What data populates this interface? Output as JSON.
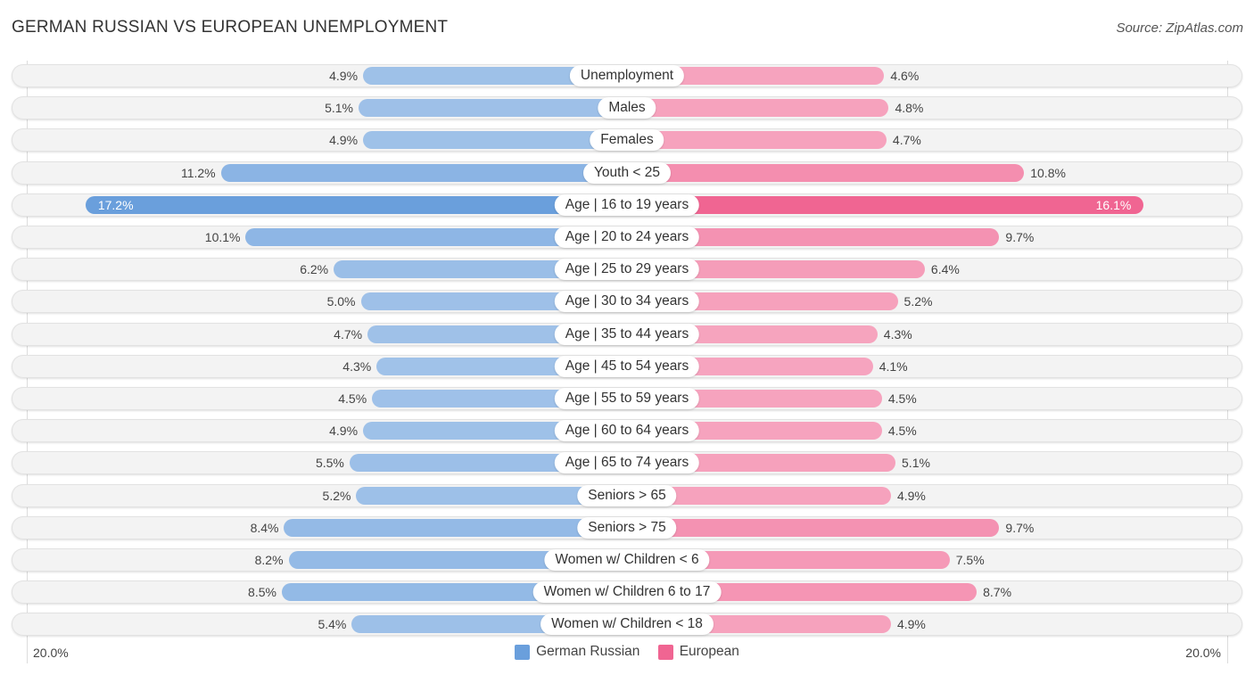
{
  "chart_data": {
    "type": "bar",
    "orientation": "horizontal-diverging",
    "title": "GERMAN RUSSIAN VS EUROPEAN UNEMPLOYMENT",
    "source": "Source: ZipAtlas.com",
    "categories": [
      "Unemployment",
      "Males",
      "Females",
      "Youth < 25",
      "Age | 16 to 19 years",
      "Age | 20 to 24 years",
      "Age | 25 to 29 years",
      "Age | 30 to 34 years",
      "Age | 35 to 44 years",
      "Age | 45 to 54 years",
      "Age | 55 to 59 years",
      "Age | 60 to 64 years",
      "Age | 65 to 74 years",
      "Seniors > 65",
      "Seniors > 75",
      "Women w/ Children < 6",
      "Women w/ Children 6 to 17",
      "Women w/ Children < 18"
    ],
    "series": [
      {
        "name": "German Russian",
        "color": "#6a9fdc",
        "side": "left",
        "values": [
          4.9,
          5.1,
          4.9,
          11.2,
          17.2,
          10.1,
          6.2,
          5.0,
          4.7,
          4.3,
          4.5,
          4.9,
          5.5,
          5.2,
          8.4,
          8.2,
          8.5,
          5.4
        ]
      },
      {
        "name": "European",
        "color": "#f06592",
        "side": "right",
        "values": [
          4.6,
          4.8,
          4.7,
          10.8,
          16.1,
          9.7,
          6.4,
          5.2,
          4.3,
          4.1,
          4.5,
          4.5,
          5.1,
          4.9,
          9.7,
          7.5,
          8.7,
          4.9
        ]
      }
    ],
    "value_suffix": "%",
    "axis": {
      "left_tick": "20.0%",
      "right_tick": "20.0%",
      "max": 20.0
    },
    "highlight_index": 4,
    "legend": {
      "position": "bottom-center",
      "entries": [
        "German Russian",
        "European"
      ]
    }
  }
}
